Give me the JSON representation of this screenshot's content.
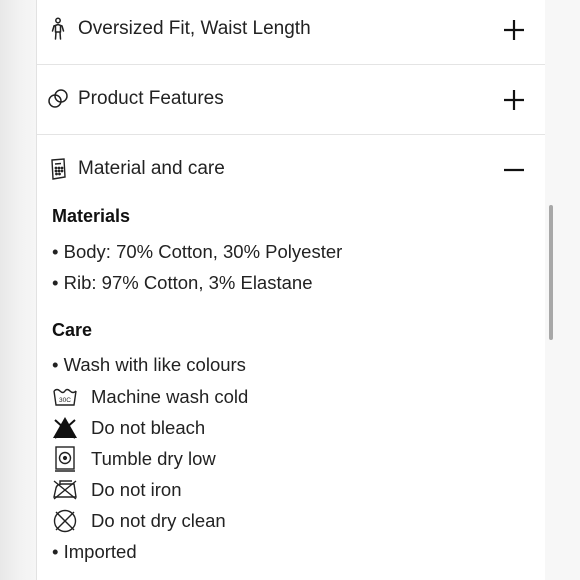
{
  "accordion": {
    "items": [
      {
        "label": "Oversized Fit, Waist Length",
        "icon": "person-fit-icon",
        "state": "collapsed"
      },
      {
        "label": "Product Features",
        "icon": "features-icon",
        "state": "collapsed"
      },
      {
        "label": "Material and care",
        "icon": "care-label-icon",
        "state": "expanded"
      }
    ]
  },
  "material_care": {
    "materials_title": "Materials",
    "materials": [
      "• Body: 70% Cotton, 30% Polyester",
      "• Rib: 97% Cotton, 3% Elastane"
    ],
    "care_title": "Care",
    "care_bullet_1": "• Wash with like colours",
    "care_instructions": [
      {
        "icon": "machine-wash-30c-icon",
        "text": "Machine wash cold",
        "icon_text": "30C"
      },
      {
        "icon": "do-not-bleach-icon",
        "text": "Do not bleach"
      },
      {
        "icon": "tumble-dry-low-icon",
        "text": "Tumble dry low"
      },
      {
        "icon": "do-not-iron-icon",
        "text": "Do not iron"
      },
      {
        "icon": "do-not-dry-clean-icon",
        "text": "Do not dry clean"
      }
    ],
    "care_bullet_2": "• Imported"
  }
}
